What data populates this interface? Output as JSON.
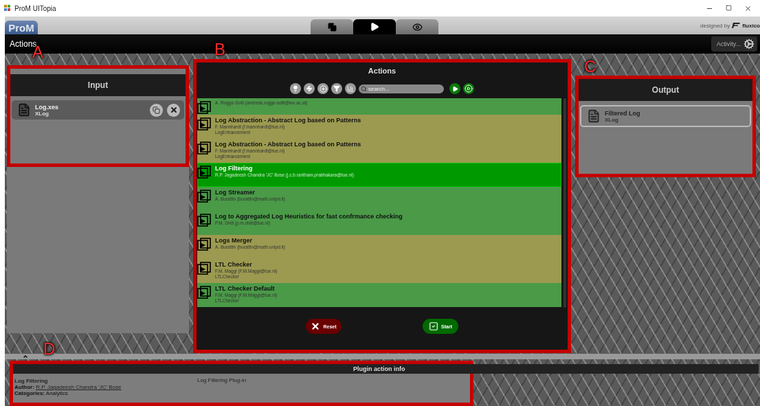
{
  "window": {
    "title": "ProM UITopia"
  },
  "header": {
    "logo": "ProM",
    "tabs": [
      {
        "kind": "workspace",
        "selected": false
      },
      {
        "kind": "actions",
        "selected": true
      },
      {
        "kind": "view",
        "selected": false
      }
    ],
    "credit": "designed by",
    "brand": "fluxico"
  },
  "toolbar": {
    "title": "Actions",
    "activity": "Activity..."
  },
  "input": {
    "annotation": "A",
    "title": "Input",
    "items": [
      {
        "name": "Log.xes",
        "type": "XLog"
      }
    ]
  },
  "actions": {
    "annotation": "B",
    "title": "Actions",
    "search": {
      "placeholder": "search..."
    },
    "rows": [
      {
        "author": "A. Rogge-Solti (andreas.rogge-solti@wu.ac.at)",
        "color": "#4a9a48",
        "selected": false
      },
      {
        "name": "Log Abstraction - Abstract Log based on Patterns",
        "author": "F. Mannhardt (f.mannhardt@tue.nl)",
        "category": "LogEnhancement",
        "color": "#9c9a50",
        "selected": false
      },
      {
        "name": "Log Abstraction - Abstract Log based on Patterns",
        "author": "F. Mannhardt (f.mannhardt@tue.nl)",
        "category": "LogEnhancement",
        "color": "#9c9a50",
        "selected": false
      },
      {
        "name": "Log Filtering",
        "author": "R.P. Jagadeesh Chandra 'JC' Bose (j.c.b.rantham.prabhakara@tue.nl)",
        "color": "#009a00",
        "selected": true
      },
      {
        "name": "Log Streamer",
        "author": "A. Burattin (burattin@math.unipd.it)",
        "color": "#4a9a48",
        "selected": false
      },
      {
        "name": "Log to Aggregated Log Heuristics for fast confrmance checking",
        "author": "P.M. Dixit (p.m.dixit@tue.nl)",
        "color": "#4a9a48",
        "selected": false
      },
      {
        "name": "Logs Merger",
        "author": "A. Burattin (burattin@math.unipd.it)",
        "color": "#9c9a50",
        "selected": false
      },
      {
        "name": "LTL Checker",
        "author": "F.M. Maggi (F.M.Maggi@tue.nl)",
        "category": "LTLChecker",
        "color": "#9c9a50",
        "selected": false
      },
      {
        "name": "LTL Checker Default",
        "author": "F.M. Maggi (F.M.Maggi@tue.nl)",
        "category": "LTLChecker",
        "color": "#4a9a48",
        "selected": false
      }
    ],
    "buttons": [
      {
        "kind": "reset",
        "label": "Reset"
      },
      {
        "kind": "start",
        "label": "Start"
      }
    ]
  },
  "output": {
    "annotation": "C",
    "title": "Output",
    "items": [
      {
        "name": "Filtered Log",
        "type": "XLog"
      }
    ]
  },
  "info": {
    "annotation": "D",
    "title": "Plugin action info",
    "name": "Log Filtering",
    "description": "Log Filtering Plug-in",
    "author_label": "Author:",
    "author": "R.P. Jagadeesh Chandra 'JC' Bose",
    "categories_label": "Categories:",
    "categories": "Analytics"
  }
}
